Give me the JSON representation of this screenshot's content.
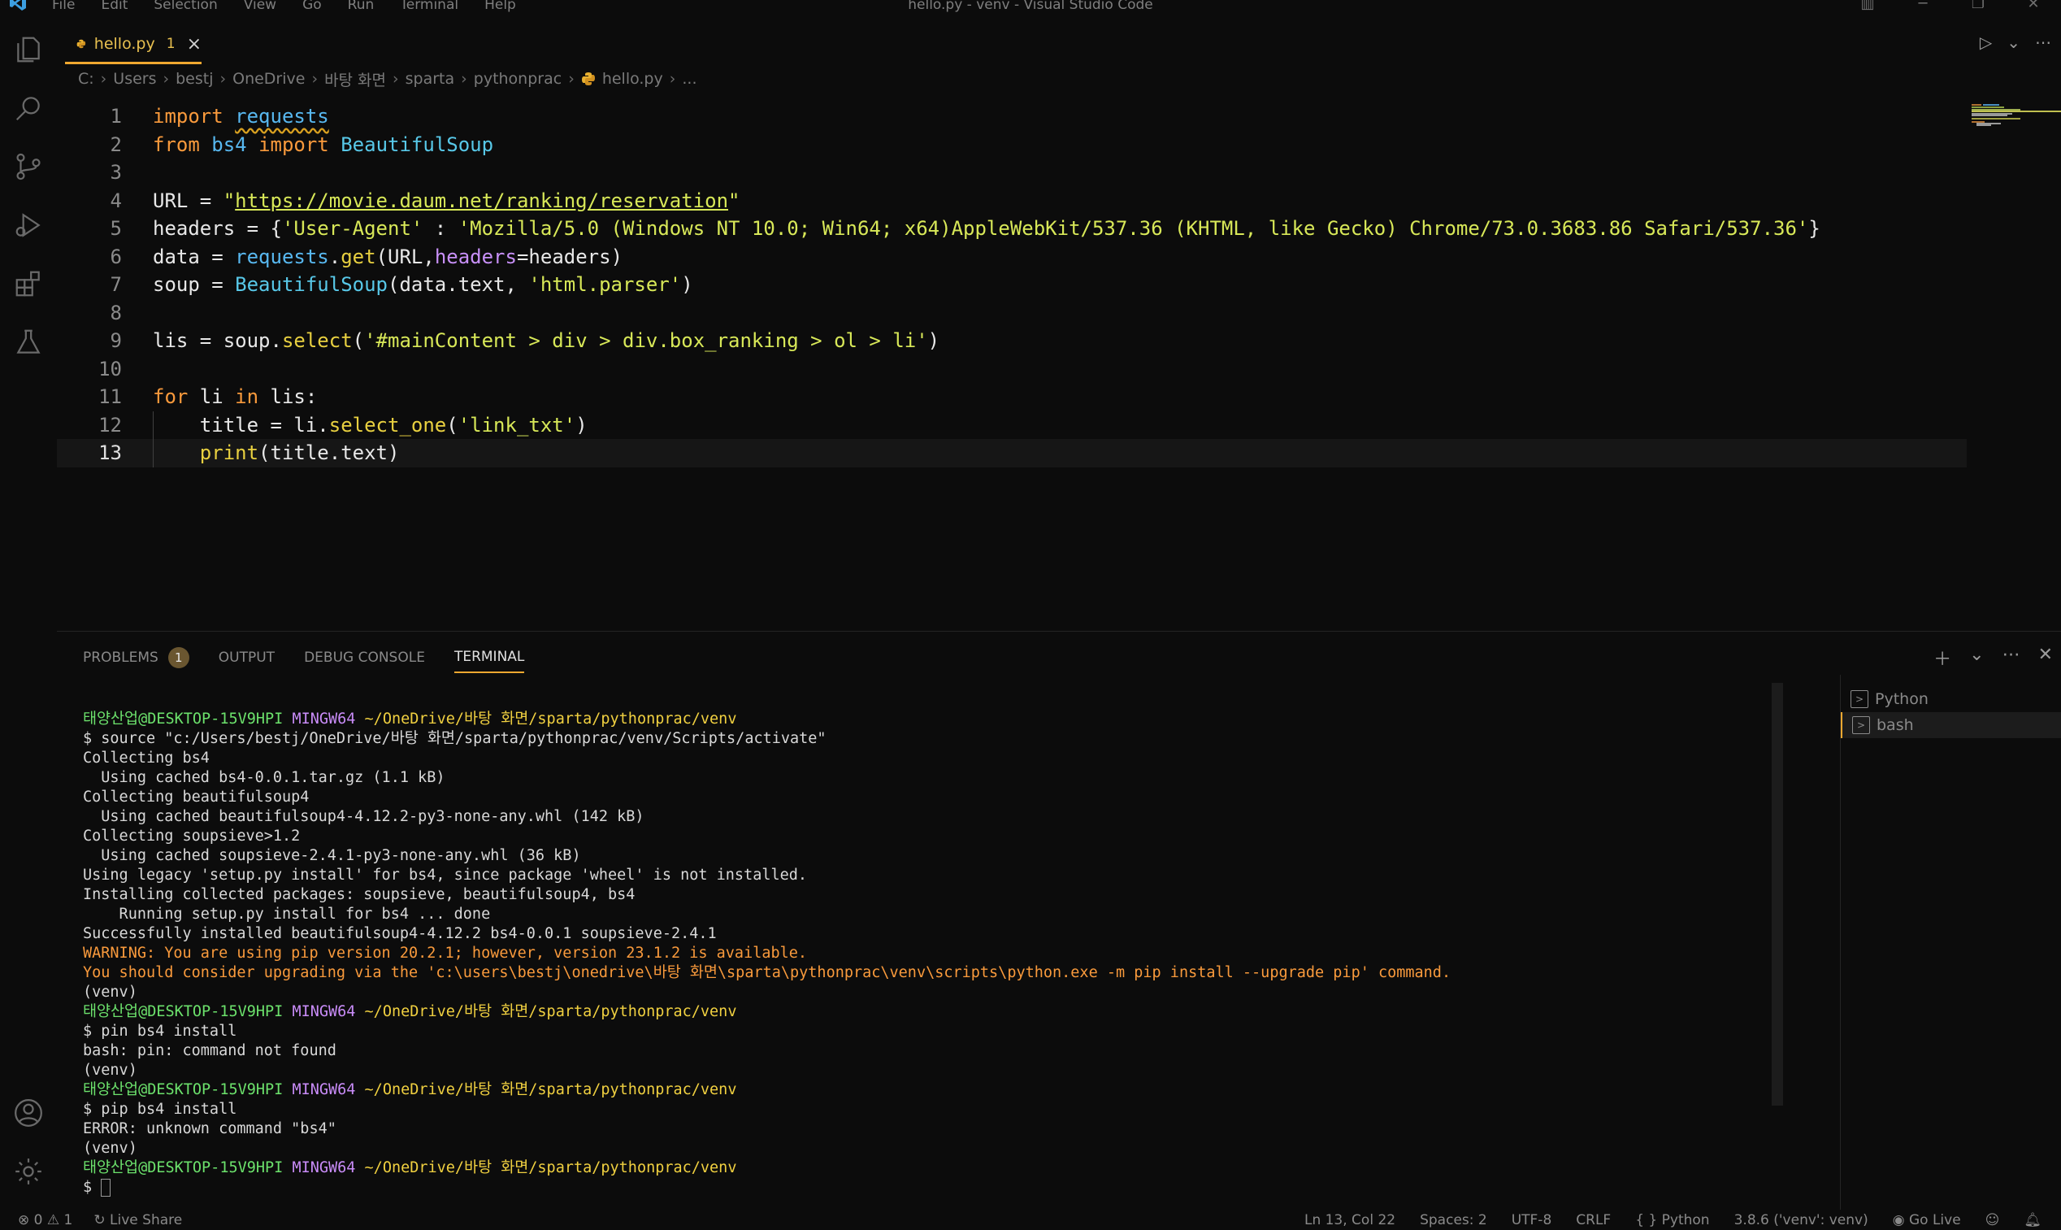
{
  "window": {
    "title": "hello.py - venv - Visual Studio Code",
    "menu": [
      "File",
      "Edit",
      "Selection",
      "View",
      "Go",
      "Run",
      "Terminal",
      "Help"
    ]
  },
  "activity_bar": [
    "explorer-icon",
    "search-icon",
    "source-control-icon",
    "run-debug-icon",
    "extensions-icon",
    "testing-icon",
    "account-icon",
    "settings-gear-icon"
  ],
  "tab": {
    "label": "hello.py",
    "badge": "1",
    "close": "×"
  },
  "breadcrumb": [
    "C:",
    "Users",
    "bestj",
    "OneDrive",
    "바탕 화면",
    "sparta",
    "pythonprac",
    "hello.py",
    "..."
  ],
  "editor": {
    "line_numbers": [
      "1",
      "2",
      "3",
      "4",
      "5",
      "6",
      "7",
      "8",
      "9",
      "10",
      "11",
      "12",
      "13"
    ]
  },
  "panel": {
    "tabs": [
      {
        "label": "PROBLEMS",
        "badge": "1"
      },
      {
        "label": "OUTPUT"
      },
      {
        "label": "DEBUG CONSOLE"
      },
      {
        "label": "TERMINAL"
      }
    ],
    "terminals": [
      "Python",
      "bash"
    ],
    "prompt": {
      "user": "태양산업@DESKTOP-15V9HPI",
      "shell": "MINGW64",
      "path": "~/OneDrive/바탕 화면/sparta/pythonprac/venv"
    },
    "terminal_lines": {
      "source_cmd": "$ source \"c:/Users/bestj/OneDrive/바탕 화면/sparta/pythonprac/venv/Scripts/activate\"",
      "l1": "Collecting bs4",
      "l2": "  Using cached bs4-0.0.1.tar.gz (1.1 kB)",
      "l3": "Collecting beautifulsoup4",
      "l4": "  Using cached beautifulsoup4-4.12.2-py3-none-any.whl (142 kB)",
      "l5": "Collecting soupsieve>1.2",
      "l6": "  Using cached soupsieve-2.4.1-py3-none-any.whl (36 kB)",
      "l7": "Using legacy 'setup.py install' for bs4, since package 'wheel' is not installed.",
      "l8": "Installing collected packages: soupsieve, beautifulsoup4, bs4",
      "l9": "    Running setup.py install for bs4 ... done",
      "l10": "Successfully installed beautifulsoup4-4.12.2 bs4-0.0.1 soupsieve-2.4.1",
      "warn1": "WARNING: You are using pip version 20.2.1; however, version 23.1.2 is available.",
      "warn2": "You should consider upgrading via the 'c:\\users\\bestj\\onedrive\\바탕 화면\\sparta\\pythonprac\\venv\\scripts\\python.exe -m pip install --upgrade pip' command.",
      "venv": "(venv)",
      "cmd2": "$ pin bs4 install",
      "err2": "bash: pin: command not found",
      "cmd3": "$ pip bs4 install",
      "err3": "ERROR: unknown command \"bs4\"",
      "dollar": "$"
    }
  },
  "status": {
    "errors": "0",
    "warnings": "1",
    "live_share": "Live Share",
    "position": "Ln 13, Col 22",
    "spaces": "Spaces: 2",
    "encoding": "UTF-8",
    "eol": "CRLF",
    "language": "Python",
    "interpreter": "3.8.6 ('venv': venv)",
    "go_live": "Go Live"
  }
}
